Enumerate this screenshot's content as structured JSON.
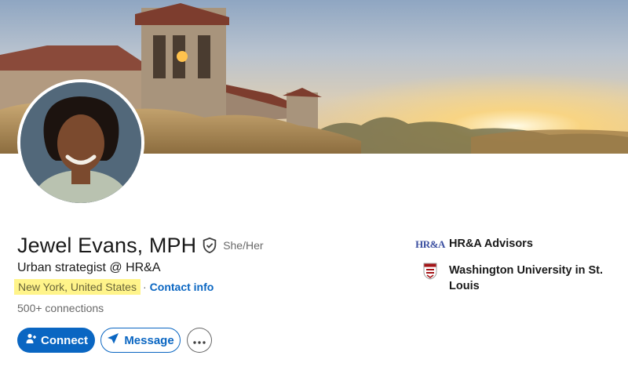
{
  "profile": {
    "name": "Jewel Evans, MPH",
    "pronouns": "She/Her",
    "headline": "Urban strategist @ HR&A",
    "location": "New York, United States",
    "location_separator": "·",
    "contact_info_label": "Contact info",
    "connections": "500+ connections"
  },
  "actions": {
    "connect_label": "Connect",
    "message_label": "Message",
    "more_label": "More actions"
  },
  "sidebar": {
    "items": [
      {
        "label": "HR&A Advisors",
        "logo": "HR&A",
        "icon": "company-logo"
      },
      {
        "label": "Washington University in St. Louis",
        "icon": "university-crest"
      }
    ]
  },
  "colors": {
    "brand": "#0a66c2",
    "highlight": "#fff48a",
    "crest_red": "#a51417"
  },
  "icons": {
    "verified": "shield-check-icon",
    "connect": "add-person-icon",
    "message": "paper-plane-icon",
    "more": "ellipsis-icon"
  }
}
